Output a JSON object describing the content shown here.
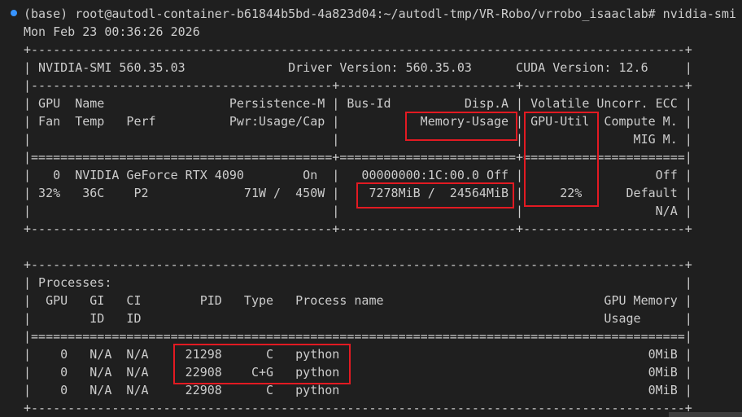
{
  "terminal": {
    "lines": [
      "(base) root@autodl-container-b61844b5bd-4a823d04:~/autodl-tmp/VR-Robo/vrrobo_isaaclab# nvidia-smi",
      "Mon Feb 23 00:36:26 2026",
      "+-----------------------------------------------------------------------------------------+",
      "| NVIDIA-SMI 560.35.03              Driver Version: 560.35.03      CUDA Version: 12.6     |",
      "|-----------------------------------------+------------------------+----------------------+",
      "| GPU  Name                 Persistence-M | Bus-Id          Disp.A | Volatile Uncorr. ECC |",
      "| Fan  Temp   Perf          Pwr:Usage/Cap |           Memory-Usage | GPU-Util  Compute M. |",
      "|                                         |                        |               MIG M. |",
      "|=========================================+========================+======================|",
      "|   0  NVIDIA GeForce RTX 4090        On  |   00000000:1C:00.0 Off |                  Off |",
      "| 32%   36C    P2             71W /  450W |    7278MiB /  24564MiB |     22%      Default |",
      "|                                         |                        |                  N/A |",
      "+-----------------------------------------+------------------------+----------------------+",
      "",
      "+-----------------------------------------------------------------------------------------+",
      "| Processes:                                                                              |",
      "|  GPU   GI   CI        PID   Type   Process name                              GPU Memory |",
      "|        ID   ID                                                               Usage      |",
      "|=========================================================================================|",
      "|    0   N/A  N/A     21298      C   python                                          0MiB |",
      "|    0   N/A  N/A     22908    C+G   python                                          0MiB |",
      "|    0   N/A  N/A     22908      C   python                                          0MiB |",
      "+-----------------------------------------------------------------------------------------+"
    ]
  },
  "colors": {
    "background": "#1f1f1f",
    "text": "#cccccc",
    "highlight_box": "#e21a22",
    "prompt_marker": "#3794ff"
  }
}
